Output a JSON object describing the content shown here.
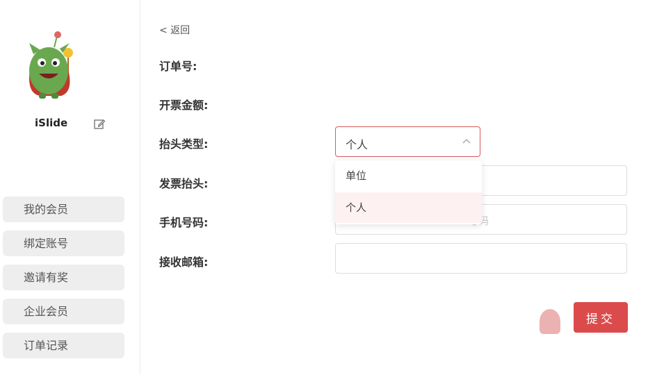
{
  "sidebar": {
    "username": "iSlide",
    "menu": [
      {
        "label": "我的会员"
      },
      {
        "label": "绑定账号"
      },
      {
        "label": "邀请有奖"
      },
      {
        "label": "企业会员"
      },
      {
        "label": "订单记录"
      }
    ]
  },
  "main": {
    "back_label": "< 返回",
    "fields": {
      "order_no_label": "订单号:",
      "amount_label": "开票金额:",
      "title_type_label": "抬头类型:",
      "invoice_title_label": "发票抬头:",
      "phone_label": "手机号码:",
      "email_label": "接收邮箱:"
    },
    "title_type": {
      "selected": "个人",
      "options": [
        "单位",
        "个人"
      ]
    },
    "phone_placeholder": "号码",
    "submit_label": "提交"
  },
  "colors": {
    "accent": "#dc4b4b",
    "selected_option_bg": "#fdf1f1"
  }
}
